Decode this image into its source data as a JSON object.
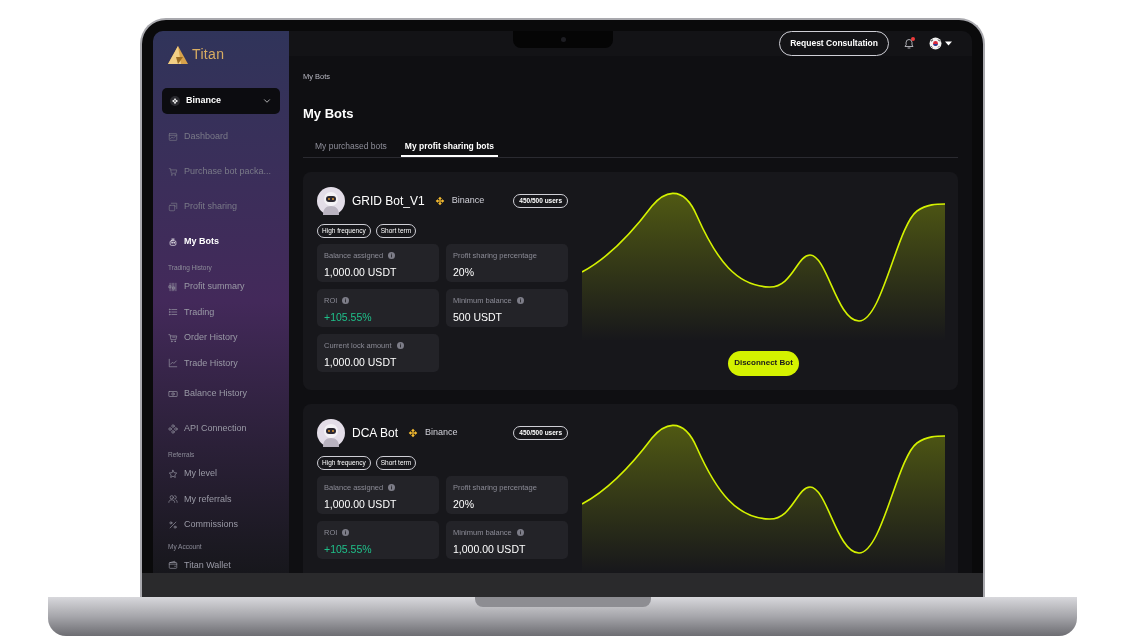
{
  "logo": "Titan",
  "header": {
    "consult_button": "Request Consultation",
    "notifications": {
      "unread": true
    }
  },
  "exchange_select": "Binance",
  "sidebar": {
    "groups": [
      {
        "items": [
          {
            "label": "Dashboard",
            "selected": false,
            "disabled": true
          },
          {
            "label": "Purchase bot packa...",
            "selected": false,
            "disabled": true
          },
          {
            "label": "Profit sharing",
            "selected": false,
            "disabled": true
          },
          {
            "label": "My Bots",
            "selected": true,
            "disabled": false
          }
        ]
      },
      {
        "label": "Trading History",
        "items": [
          {
            "label": "Profit summary",
            "selected": false,
            "disabled": false
          },
          {
            "label": "Trading",
            "selected": false,
            "disabled": false
          },
          {
            "label": "Order History",
            "selected": false,
            "disabled": false
          },
          {
            "label": "Trade History",
            "selected": false,
            "disabled": false
          }
        ]
      },
      {
        "items": [
          {
            "label": "Balance History",
            "selected": false,
            "disabled": false
          }
        ]
      },
      {
        "items": [
          {
            "label": "API Connection",
            "selected": false,
            "disabled": false
          }
        ]
      },
      {
        "label": "Referrals",
        "items": [
          {
            "label": "My level",
            "selected": false,
            "disabled": false
          },
          {
            "label": "My referrals",
            "selected": false,
            "disabled": false
          },
          {
            "label": "Commissions",
            "selected": false,
            "disabled": false
          }
        ]
      },
      {
        "label": "My Account",
        "items": [
          {
            "label": "Titan Wallet",
            "selected": false,
            "disabled": false
          }
        ]
      }
    ]
  },
  "breadcrumb": "My Bots",
  "title": "My Bots",
  "tabs": [
    {
      "label": "My purchased bots",
      "selected": false
    },
    {
      "label": "My profit sharing bots",
      "selected": true
    }
  ],
  "bots": [
    {
      "name": "GRID Bot_V1",
      "exchange": "Binance",
      "users": "450/500 users",
      "tags": [
        "High frequency",
        "Short term"
      ],
      "stats": [
        {
          "label": "Balance assigned",
          "value": "1,000.00 USDT",
          "info": true,
          "kind": "plain"
        },
        {
          "label": "Profit sharing percentage",
          "value": "20%",
          "info": false,
          "kind": "plain"
        },
        {
          "label": "ROI",
          "value": "+105.55%",
          "info": true,
          "kind": "gain"
        },
        {
          "label": "Minimum balance",
          "value": "500 USDT",
          "info": true,
          "kind": "plain"
        },
        {
          "label": "Current lock amount",
          "value": "1,000.00 USDT",
          "info": true,
          "kind": "plain"
        }
      ],
      "action": "Disconnect Bot"
    },
    {
      "name": "DCA Bot",
      "exchange": "Binance",
      "users": "450/500 users",
      "tags": [
        "High frequency",
        "Short term"
      ],
      "stats": [
        {
          "label": "Balance assigned",
          "value": "1,000.00 USDT",
          "info": true,
          "kind": "plain"
        },
        {
          "label": "Profit sharing percentage",
          "value": "20%",
          "info": false,
          "kind": "plain"
        },
        {
          "label": "ROI",
          "value": "+105.55%",
          "info": true,
          "kind": "gain"
        },
        {
          "label": "Minimum balance",
          "value": "1,000.00 USDT",
          "info": true,
          "kind": "plain"
        }
      ]
    }
  ]
}
